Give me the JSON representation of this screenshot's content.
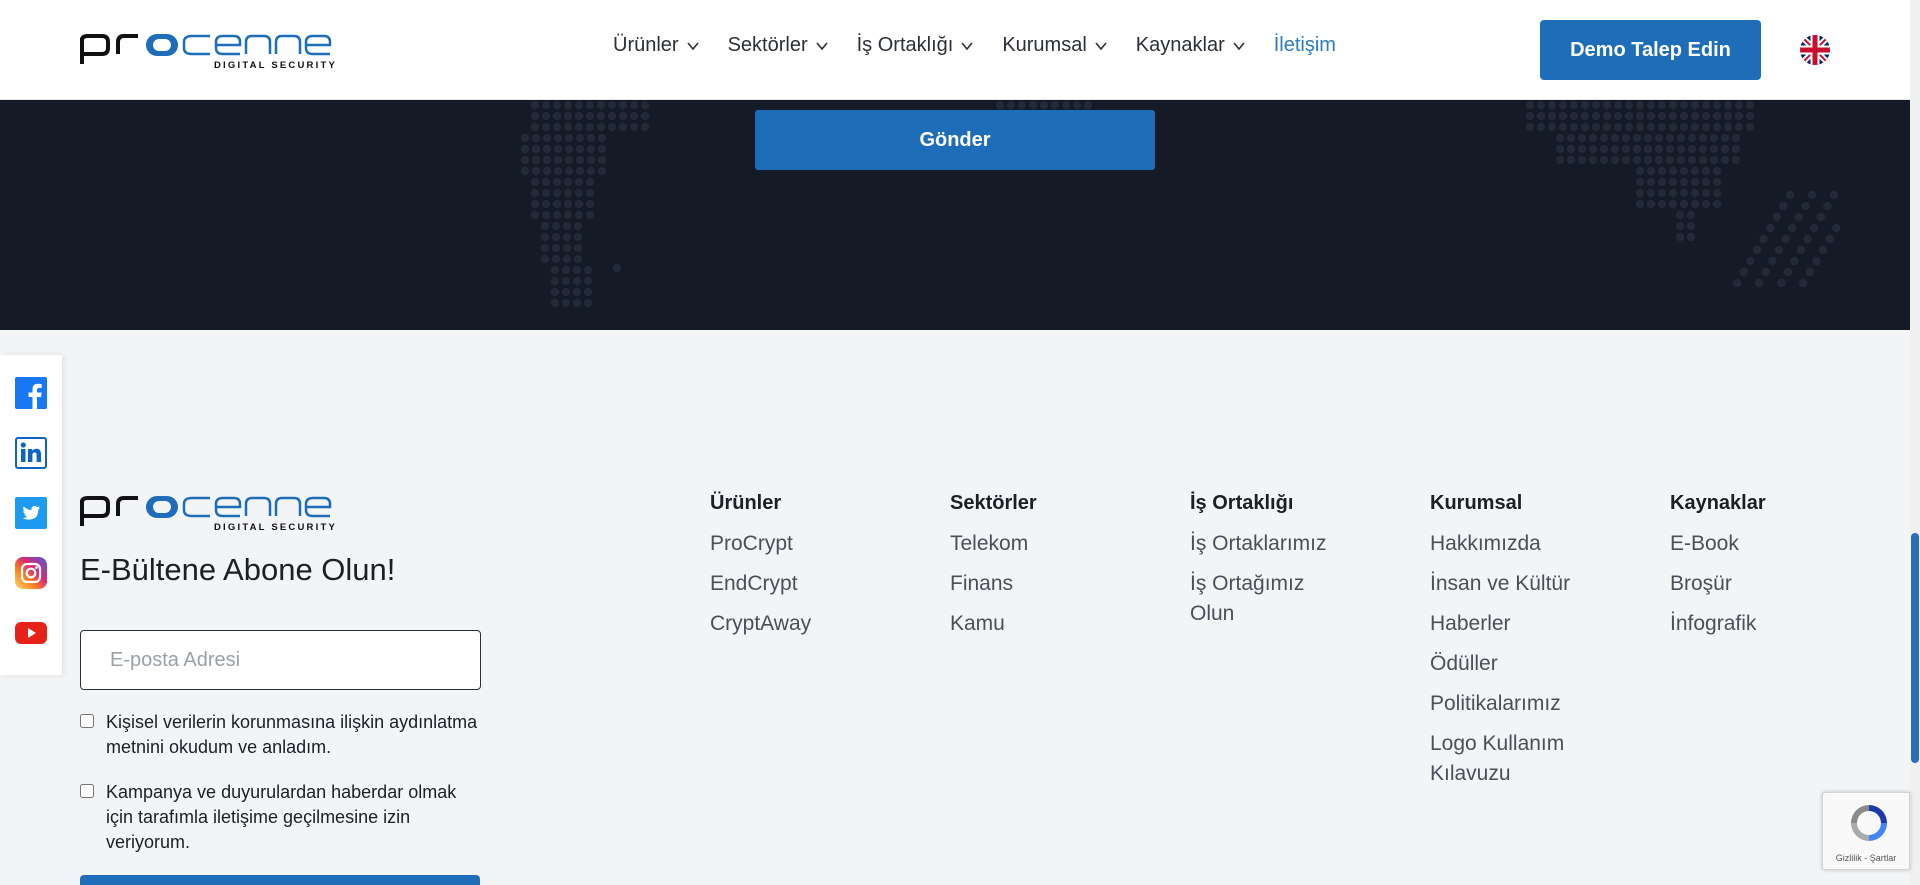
{
  "header": {
    "logo_text": "procenne",
    "logo_sub": "DIGITAL SECURITY",
    "nav": [
      {
        "label": "Ürünler",
        "dropdown": true
      },
      {
        "label": "Sektörler",
        "dropdown": true
      },
      {
        "label": "İş Ortaklığı",
        "dropdown": true
      },
      {
        "label": "Kurumsal",
        "dropdown": true
      },
      {
        "label": "Kaynaklar",
        "dropdown": true
      },
      {
        "label": "İletişim",
        "dropdown": false,
        "active": true
      }
    ],
    "demo_button": "Demo Talep Edin",
    "language_icon": "uk-flag-icon"
  },
  "contact": {
    "send_button": "Gönder"
  },
  "social": [
    "facebook-icon",
    "linkedin-icon",
    "twitter-icon",
    "instagram-icon",
    "youtube-icon"
  ],
  "footer": {
    "logo_text": "procenne",
    "logo_sub": "DIGITAL SECURITY",
    "newsletter_title": "E-Bültene Abone Olun!",
    "email_placeholder": "E-posta Adresi",
    "consent_1": "Kişisel verilerin korunmasına ilişkin aydınlatma metnini okudum ve anladım.",
    "consent_2": "Kampanya ve duyurulardan haberdar olmak için tarafımla iletişime geçilmesine izin veriyorum.",
    "columns": [
      {
        "title": "Ürünler",
        "links": [
          "ProCrypt",
          "EndCrypt",
          "CryptAway"
        ]
      },
      {
        "title": "Sektörler",
        "links": [
          "Telekom",
          "Finans",
          "Kamu"
        ]
      },
      {
        "title": "İş Ortaklığı",
        "links": [
          "İş Ortaklarımız",
          "İş Ortağımız Olun"
        ]
      },
      {
        "title": "Kurumsal",
        "links": [
          "Hakkımızda",
          "İnsan ve Kültür",
          "Haberler",
          "Ödüller",
          "Politikalarımız",
          "Logo Kullanım Kılavuzu"
        ]
      },
      {
        "title": "Kaynaklar",
        "links": [
          "E-Book",
          "Broşür",
          "İnfografik"
        ]
      }
    ]
  },
  "recaptcha": {
    "label": "Gizlilik - Şartlar"
  },
  "colors": {
    "brand_blue": "#1e6db8",
    "dark_bg": "#141a26",
    "footer_bg": "#f3f4f6",
    "active_link": "#2a7bc0"
  }
}
